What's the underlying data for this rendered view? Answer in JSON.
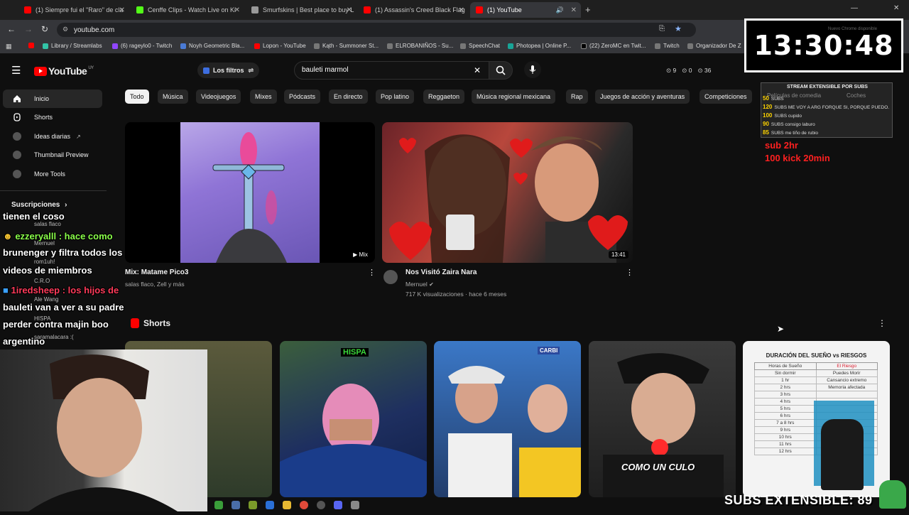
{
  "browser": {
    "tabs": [
      {
        "label": "(1) Siempre fui el \"Raro\" de cla",
        "color": "#ff0000"
      },
      {
        "label": "Cenffe Clips - Watch Live on Ki",
        "color": "#53fc18"
      },
      {
        "label": "Smurfskins | Best place to buy L",
        "color": "#999999"
      },
      {
        "label": "(1) Assassin's Creed Black Flag",
        "color": "#ff0000"
      },
      {
        "label": "(1) YouTube",
        "color": "#ff0000"
      }
    ],
    "new_tab": "+",
    "url": "youtube.com",
    "bookmarks": [
      "Library / Streamlabs",
      "(6) rageylo0 - Twitch",
      "Noyh Geometric Bla...",
      "Lopon - YouTube",
      "Kąth - Summoner St...",
      "ELROBANIÑOS - Su...",
      "SpeechChat",
      "Photopea | Online P...",
      "(22) ZeroMC en Twit...",
      "Twitch",
      "Organizador De Z"
    ]
  },
  "youtube": {
    "logo": "YouTube",
    "logo_region": "UY",
    "filters_label": "Los filtros",
    "search_value": "bauleti marmol",
    "header_counts": [
      "9",
      "0",
      "36"
    ],
    "sidebar": [
      {
        "label": "Inicio",
        "icon": "home-icon",
        "active": true
      },
      {
        "label": "Shorts",
        "icon": "shorts-icon",
        "active": false
      },
      {
        "label": "Ideas diarias",
        "icon": "ideas-icon",
        "active": false
      },
      {
        "label": "Thumbnail Preview",
        "icon": "preview-icon",
        "active": false
      },
      {
        "label": "More Tools",
        "icon": "tools-icon",
        "active": false
      }
    ],
    "subscriptions_label": "Suscripciones",
    "subscription_ghosts": [
      "salas flaco",
      "Mernuel",
      "rom1uh!",
      "C.R.O",
      "Ale Wang",
      "HISPA",
      "saramalacara :("
    ],
    "chips": [
      "Todo",
      "Música",
      "Videojuegos",
      "Mixes",
      "Pódcasts",
      "En directo",
      "Pop latino",
      "Reggaeton",
      "Música regional mexicana",
      "Rap",
      "Juegos de acción y aventuras",
      "Competiciones"
    ],
    "videos": [
      {
        "title": "Mix: Matame Pico3",
        "meta": "salas flaco, Zell y más",
        "badge": "Mix"
      },
      {
        "title": "Nos Visitó Zaira Nara",
        "channel": "Mernuel",
        "meta": "717 K visualizaciones · hace 6 meses",
        "badge": "13:41"
      }
    ],
    "shorts_label": "Shorts",
    "short_overlays": [
      "HISPA",
      "CARBI",
      "COMO UN CULO",
      "DURACIÓN DEL SUEÑO vs RIESGOS"
    ],
    "sleep_table": {
      "headers": [
        "Horas de Sueño",
        "El Riesgo"
      ],
      "rows": [
        [
          "Sin dormir",
          "Puedes Morir"
        ],
        [
          "1 hr",
          "Cansancio extremo"
        ],
        [
          "2 hrs",
          "Memoria afectada"
        ],
        [
          "3 hrs",
          ""
        ],
        [
          "4 hrs",
          ""
        ],
        [
          "5 hrs",
          ""
        ],
        [
          "6 hrs",
          ""
        ],
        [
          "7 a 8 hrs",
          ""
        ],
        [
          "9 hrs",
          ""
        ],
        [
          "10 hrs",
          ""
        ],
        [
          "11 hrs",
          ""
        ],
        [
          "12 hrs",
          ""
        ]
      ]
    }
  },
  "stream_overlay": {
    "timer": "13:30:48",
    "sub_panel_title": "STREAM EXTENSIBLE POR SUBS",
    "sub_panel_tabs": [
      "Películas de comedia",
      "Coches"
    ],
    "sub_rows": [
      {
        "n": "50",
        "text": "SUBS"
      },
      {
        "n": "120",
        "text": "SUBS  ME VOY A ARG FORQUE SI, PORQUE PUEDO."
      },
      {
        "n": "100",
        "text": "SUBS  cupido"
      },
      {
        "n": "90",
        "text": "SUBS  consigo laburo"
      },
      {
        "n": "85",
        "text": "SUBS  me tiño de rubio"
      }
    ],
    "red_lines": [
      "sub 2hr",
      "100 kick 20min"
    ],
    "chat_lines": [
      "tienen el coso",
      "ezzeryalll : hace como",
      "brunenger y filtra todos los",
      "videos de miembros",
      "1iredsheep : los hijos de",
      "bauleti van a ver a su padre",
      "perder contra majin boo",
      "argentino"
    ],
    "subs_extensible": "SUBS EXTENSIBLE: 89",
    "chrome_badge": "Nuevo Chrome disponible"
  }
}
